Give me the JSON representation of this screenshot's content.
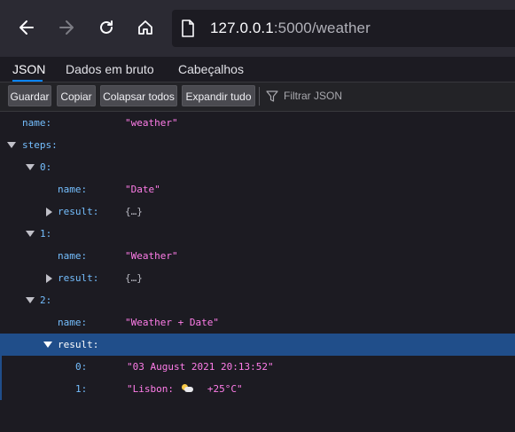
{
  "browser": {
    "url_host": "127.0.0.1",
    "url_rest": ":5000/weather",
    "icons": [
      "back-arrow-icon",
      "forward-arrow-icon",
      "reload-icon",
      "home-icon",
      "page-icon"
    ]
  },
  "viewer": {
    "tabs": [
      "JSON",
      "Dados em bruto",
      "Cabeçalhos"
    ],
    "active_tab": "JSON",
    "toolbar": {
      "save": "Guardar",
      "copy": "Copiar",
      "collapse_all": "Colapsar todos",
      "expand_all": "Expandir tudo",
      "filter_placeholder": "Filtrar JSON"
    }
  },
  "tree": {
    "name_key": "name:",
    "name_val": "\"weather\"",
    "steps_key": "steps:",
    "step0": {
      "index": "0:",
      "name_key": "name:",
      "name_val": "\"Date\"",
      "result_key": "result:",
      "result_val": "{…}"
    },
    "step1": {
      "index": "1:",
      "name_key": "name:",
      "name_val": "\"Weather\"",
      "result_key": "result:",
      "result_val": "{…}"
    },
    "step2": {
      "index": "2:",
      "name_key": "name:",
      "name_val": "\"Weather + Date\"",
      "result_key": "result:",
      "items": [
        {
          "index": "0:",
          "value": "\"03 August 2021 20:13:52\""
        },
        {
          "index": "1:",
          "value_before": "\"Lisbon: ",
          "icon": "sun-behind-cloud-icon",
          "value_after": "  +25°C\""
        }
      ]
    }
  },
  "colors": {
    "key": "#75bfff",
    "string": "#ff7de9",
    "selection": "#204e8a",
    "tab_accent": "#0a84ff"
  }
}
